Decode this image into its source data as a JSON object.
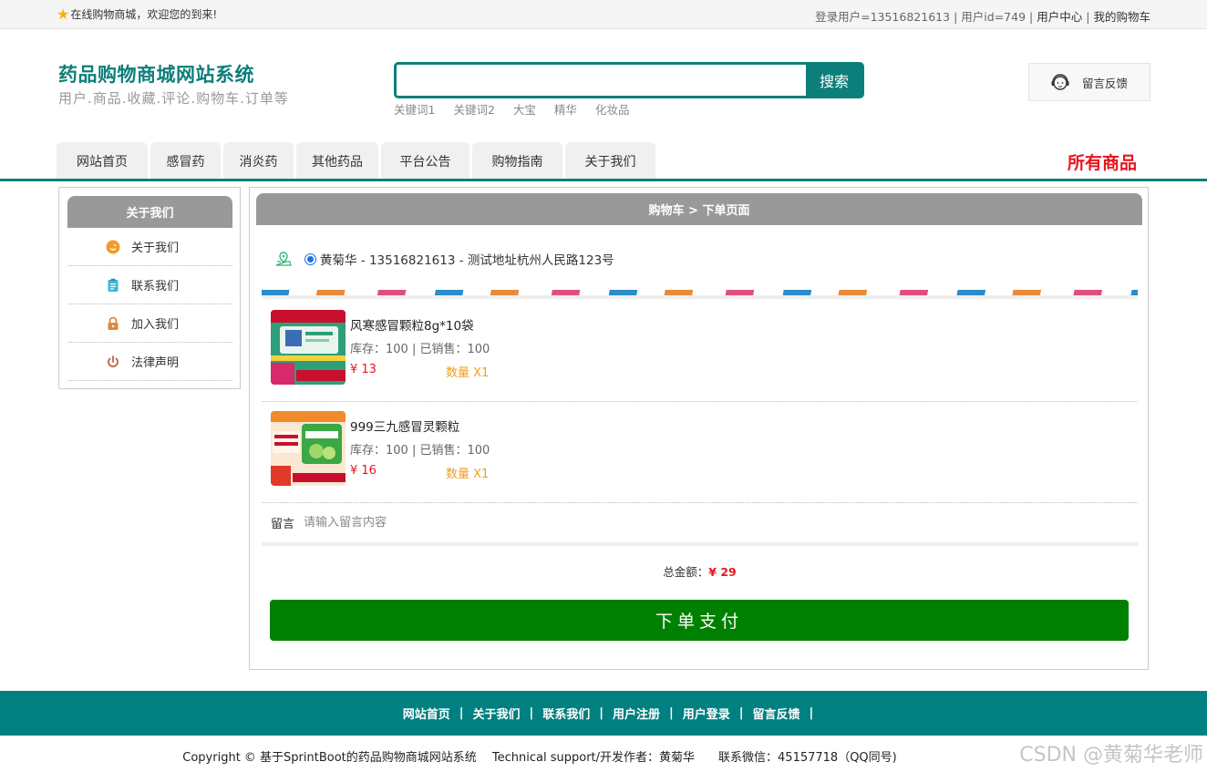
{
  "topbar": {
    "welcome": "在线购物商城，欢迎您的到来!",
    "login_user": "登录用户=13516821613",
    "user_id": "用户id=749",
    "user_center": "用户中心",
    "my_cart": "我的购物车"
  },
  "header": {
    "title": "药品购物商城网站系统",
    "subtitle": "用户.商品.收藏.评论.购物车.订单等",
    "search_placeholder": "",
    "search_button": "搜索",
    "keywords": [
      "关键词1",
      "关键词2",
      "大宝",
      "精华",
      "化妆品"
    ],
    "feedback": "留言反馈"
  },
  "nav": {
    "tabs": [
      "网站首页",
      "感冒药",
      "消炎药",
      "其他药品",
      "平台公告",
      "购物指南",
      "关于我们"
    ],
    "all_goods": "所有商品"
  },
  "sidebar": {
    "title": "关于我们",
    "items": [
      "关于我们",
      "联系我们",
      "加入我们",
      "法律声明"
    ]
  },
  "order": {
    "header": "购物车 > 下单页面",
    "address": "黄菊华 - 13516821613 - 测试地址杭州人民路123号",
    "items": [
      {
        "name": "风寒感冒颗粒8g*10袋",
        "stock": "库存：100 | 已销售：100",
        "price": "¥ 13",
        "qty": "数量 X1"
      },
      {
        "name": "999三九感冒灵颗粒",
        "stock": "库存：100 | 已销售：100",
        "price": "¥ 16",
        "qty": "数量 X1"
      }
    ],
    "note_label": "留言",
    "note_placeholder": "请输入留言内容",
    "total_label": "总金额：",
    "total_amount": "¥ 29",
    "pay_button": "下单支付"
  },
  "footer": {
    "links": [
      "网站首页",
      "关于我们",
      "联系我们",
      "用户注册",
      "用户登录",
      "留言反馈"
    ],
    "copyright": "Copyright © 基于SprintBoot的药品购物商城网站系统　 Technical support/开发作者：黄菊华　　联系微信：45157718（QQ同号)",
    "watermark": "CSDN @黄菊华老师"
  },
  "colors": {
    "brand": "#0d7f7a",
    "footer": "#008080",
    "pay": "#008000",
    "price": "#e8141e",
    "qty": "#f0a020"
  }
}
